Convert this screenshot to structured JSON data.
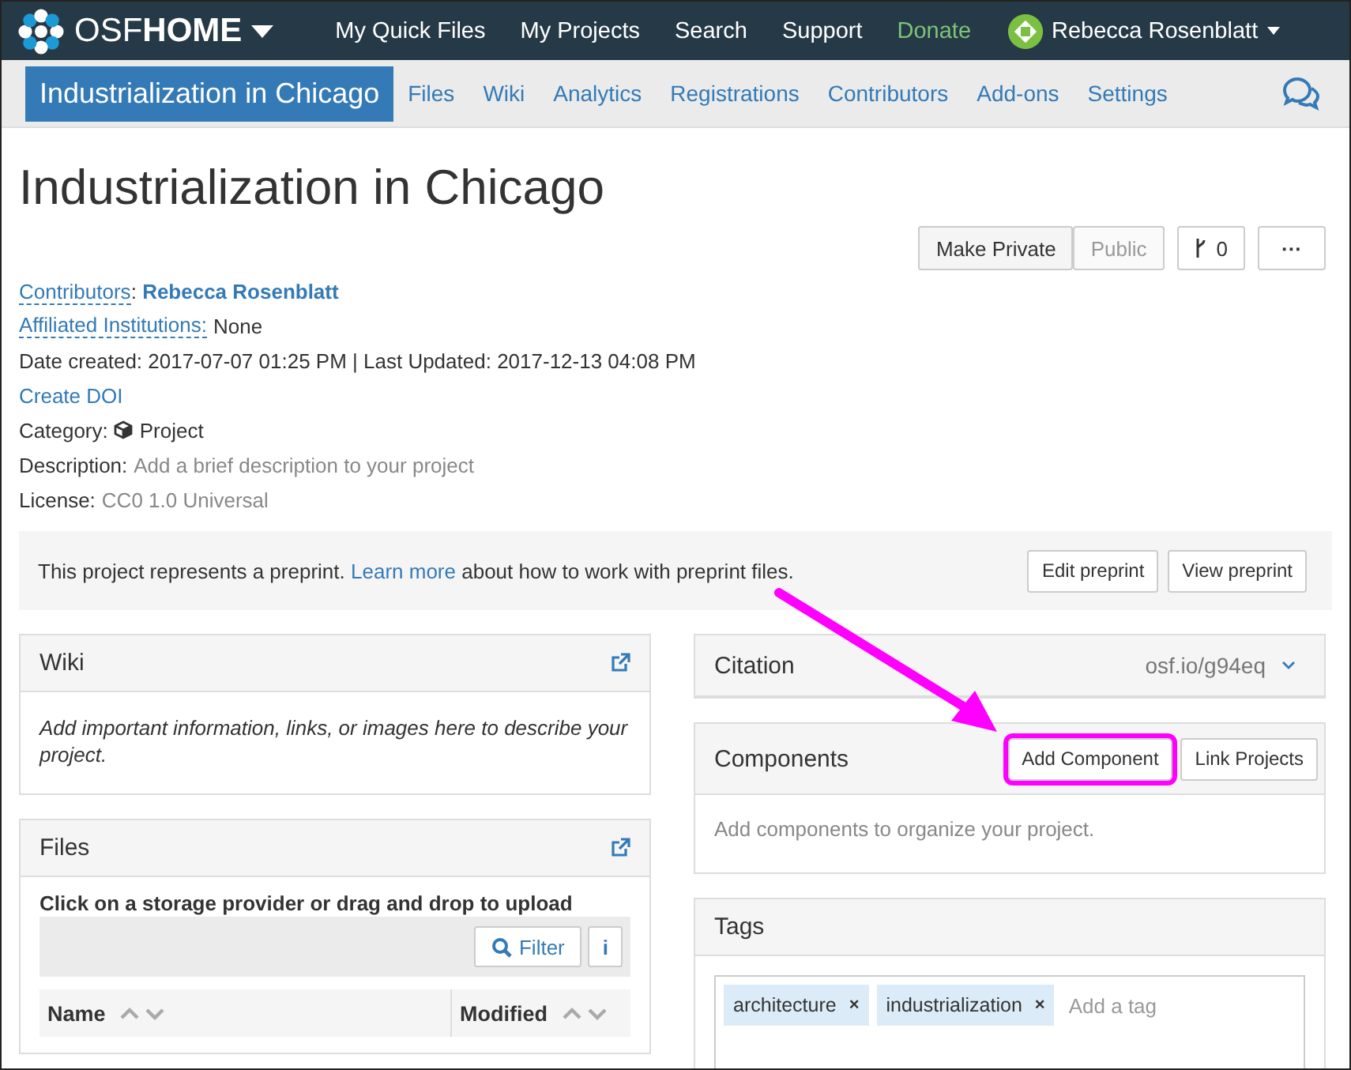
{
  "navbar": {
    "brand_light": "OSF",
    "brand_bold": "HOME",
    "links": [
      {
        "label": "My Quick Files",
        "kind": "link"
      },
      {
        "label": "My Projects",
        "kind": "link"
      },
      {
        "label": "Search",
        "kind": "link"
      },
      {
        "label": "Support",
        "kind": "link"
      },
      {
        "label": "Donate",
        "kind": "donate"
      }
    ],
    "user": "Rebecca Rosenblatt"
  },
  "project_nav": {
    "title": "Industrialization in Chicago",
    "links": [
      "Files",
      "Wiki",
      "Analytics",
      "Registrations",
      "Contributors",
      "Add-ons",
      "Settings"
    ]
  },
  "project": {
    "title": "Industrialization in Chicago",
    "make_private": "Make Private",
    "public": "Public",
    "forks": "0",
    "more": "···"
  },
  "meta": {
    "contributors_label": "Contributors",
    "contributors_sep": ":",
    "contributors_value": "Rebecca Rosenblatt",
    "institutions_label": "Affiliated Institutions:",
    "institutions_value": "None",
    "dates": "Date created: 2017-07-07 01:25 PM | Last Updated: 2017-12-13 04:08 PM",
    "create_doi": "Create DOI",
    "category_label": "Category:",
    "category_value": "Project",
    "description_label": "Description:",
    "description_value": "Add a brief description to your project",
    "license_label": "License:",
    "license_value": "CC0 1.0 Universal"
  },
  "preprint_banner": {
    "before": "This project represents a preprint.",
    "link": "Learn more",
    "after": "about how to work with preprint files.",
    "buttons": [
      "Edit preprint",
      "View preprint"
    ]
  },
  "wiki": {
    "title": "Wiki",
    "body": "Add important information, links, or images here to describe your project."
  },
  "files": {
    "title": "Files",
    "hint": "Click on a storage provider or drag and drop to upload",
    "filter": "Filter",
    "info": "i",
    "columns": [
      "Name",
      "Modified"
    ]
  },
  "citation": {
    "title": "Citation",
    "link": "osf.io/g94eq"
  },
  "components": {
    "title": "Components",
    "buttons": [
      {
        "label": "Add Component",
        "highlighted": true
      },
      {
        "label": "Link Projects",
        "highlighted": false
      }
    ],
    "body": "Add components to organize your project."
  },
  "tags": {
    "title": "Tags",
    "items": [
      {
        "label": "architecture",
        "remove": "×"
      },
      {
        "label": "industrialization",
        "remove": "×"
      }
    ],
    "placeholder": "Add a tag"
  },
  "annotation": {
    "kind": "arrow"
  }
}
